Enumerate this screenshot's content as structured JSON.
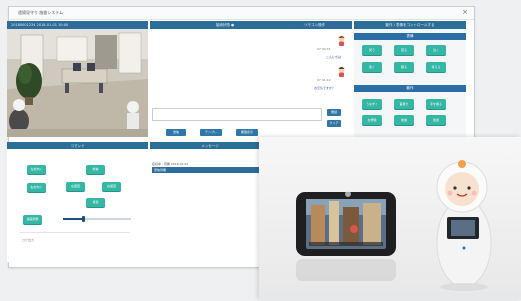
{
  "window": {
    "title": "遠隔見守り 施錠システム",
    "close_glyph": "×"
  },
  "camera_panel": {
    "header": "20180001234 2018-01-01 10:00"
  },
  "chat_panel": {
    "header": "接続状態 ●",
    "header_right": "リモコン操作",
    "messages": [
      {
        "time": "07:30:35",
        "text": "こんにちは"
      },
      {
        "time": "07:31:10",
        "text": "お元気ですか？"
      }
    ],
    "buttons": [
      "送信",
      "テンプレ",
      "履歴表示"
    ],
    "side_buttons": [
      "発話",
      "クリア"
    ]
  },
  "control_panel": {
    "header": "動作 / 表情をコントロールする",
    "section1": "表情",
    "section2": "動作",
    "tiles1": [
      "笑う",
      "怒る",
      "泣く",
      "驚く",
      "眠る",
      "考える"
    ],
    "tiles2": [
      "うなずく",
      "首振り",
      "手を振る",
      "お辞儀",
      "前進",
      "後退"
    ]
  },
  "direction_panel": {
    "header": "コマンド",
    "buttons": {
      "left_top": "左を向く",
      "left_mid": "右を向く",
      "up": "前進",
      "left": "左旋回",
      "right": "右旋回",
      "down": "後退",
      "speed": "速度調整"
    },
    "speed_value": 0.3,
    "footer_label": "ログ出力"
  },
  "middle_panel": {
    "header": "メッセージ",
    "status": "接続中 : 待機 2018-01-01",
    "sub": "受信待機"
  },
  "colors": {
    "header": "#2e6c9b",
    "tile": "#34b7a5",
    "accent": "#2e77a8"
  }
}
